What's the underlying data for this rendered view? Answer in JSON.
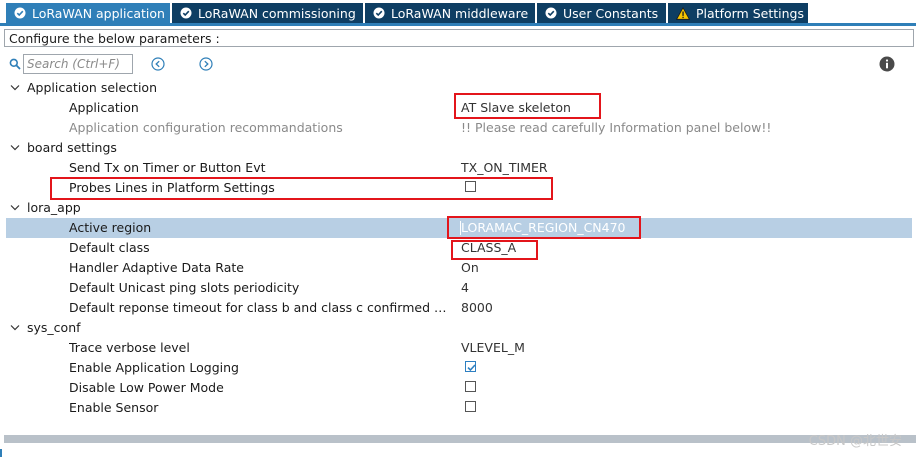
{
  "tabs": [
    {
      "label": "LoRaWAN application",
      "icon": "check-circle-icon",
      "active": true
    },
    {
      "label": "LoRaWAN commissioning",
      "icon": "check-circle-icon",
      "active": false
    },
    {
      "label": "LoRaWAN middleware",
      "icon": "check-circle-icon",
      "active": false
    },
    {
      "label": "User Constants",
      "icon": "check-circle-icon",
      "active": false
    },
    {
      "label": "Platform Settings",
      "icon": "warning-icon",
      "active": false
    }
  ],
  "configure_label": "Configure the below parameters :",
  "search": {
    "placeholder": "Search (Ctrl+F)"
  },
  "tree": {
    "application_selection": {
      "label": "Application selection",
      "application": {
        "name": "Application",
        "value": "AT Slave skeleton"
      },
      "recommendations": {
        "name": "Application configuration recommandations",
        "value": "!! Please read carefully Information panel below!!"
      }
    },
    "board_settings": {
      "label": "board settings",
      "send_tx": {
        "name": "Send Tx on Timer or Button Evt",
        "value": "TX_ON_TIMER"
      },
      "probes_lines": {
        "name": "Probes Lines in Platform Settings",
        "checked": false
      }
    },
    "lora_app": {
      "label": "lora_app",
      "active_region": {
        "name": "Active region",
        "value": "LORAMAC_REGION_CN470"
      },
      "default_class": {
        "name": "Default class",
        "value": "CLASS_A"
      },
      "adr": {
        "name": "Handler Adaptive Data Rate",
        "value": "On"
      },
      "ping_slots": {
        "name": "Default Unicast ping slots periodicity",
        "value": "4"
      },
      "timeout": {
        "name": "Default reponse timeout for class b and class c confirmed downli...",
        "value": "8000"
      }
    },
    "sys_conf": {
      "label": "sys_conf",
      "trace_level": {
        "name": "Trace verbose level",
        "value": "VLEVEL_M"
      },
      "app_logging": {
        "name": "Enable Application Logging",
        "checked": true
      },
      "low_power": {
        "name": "Disable Low Power Mode",
        "checked": false
      },
      "sensor": {
        "name": "Enable Sensor",
        "checked": false
      }
    }
  },
  "watermark": "CSDN @北世安",
  "colors": {
    "tab_dark": "#0e3e63",
    "tab_active": "#2f7fb8",
    "selected_row": "#b8cfe4",
    "highlight": "#e3151b"
  }
}
